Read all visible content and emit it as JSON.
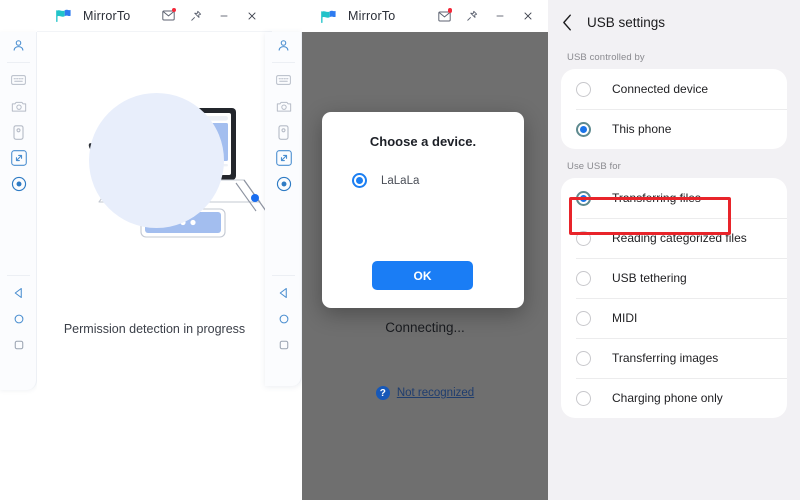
{
  "window1": {
    "title": "MirrorTo",
    "logo_icon": "mirrorto-flag-logo",
    "titlebar_buttons": [
      {
        "name": "message-icon",
        "glyph": "✉"
      },
      {
        "name": "pin-icon",
        "glyph": "✐"
      },
      {
        "name": "minimize-icon",
        "glyph": "−"
      },
      {
        "name": "close-icon",
        "glyph": "✕"
      }
    ],
    "sidebar_icons": [
      {
        "name": "profile-icon"
      },
      {
        "name": "keyboard-icon"
      },
      {
        "name": "camera-icon"
      },
      {
        "name": "device-icon"
      },
      {
        "name": "fullscreen-icon"
      },
      {
        "name": "record-icon"
      },
      {
        "name": "back-nav-icon"
      },
      {
        "name": "home-nav-icon"
      },
      {
        "name": "recents-nav-icon"
      }
    ],
    "caption": "Permission detection in progress"
  },
  "window2": {
    "title": "MirrorTo",
    "logo_icon": "mirrorto-flag-logo",
    "status_text": "Connecting...",
    "help_icon": "question-mark-icon",
    "help_glyph": "?",
    "help_label": "Not recognized",
    "dialog": {
      "title": "Choose a device.",
      "device_name": "LaLaLa",
      "ok_label": "OK"
    }
  },
  "usb_settings": {
    "back_icon": "back-chevron-icon",
    "title": "USB settings",
    "sections": [
      {
        "label": "USB controlled by",
        "options": [
          {
            "label": "Connected device",
            "selected": false
          },
          {
            "label": "This phone",
            "selected": true
          }
        ]
      },
      {
        "label": "Use USB for",
        "options": [
          {
            "label": "Transferring files",
            "selected": true,
            "highlighted": true
          },
          {
            "label": "Reading categorized files",
            "selected": false
          },
          {
            "label": "USB tethering",
            "selected": false
          },
          {
            "label": "MIDI",
            "selected": false
          },
          {
            "label": "Transferring images",
            "selected": false
          },
          {
            "label": "Charging phone only",
            "selected": false
          }
        ]
      }
    ]
  },
  "colors": {
    "accent_blue": "#1a7df5",
    "highlight_red": "#e8242a",
    "overlay_gray": "#6f6f6f",
    "panel_bg": "#f2f1f4"
  }
}
